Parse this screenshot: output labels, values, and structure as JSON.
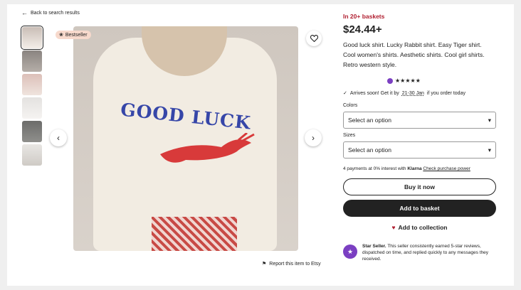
{
  "nav": {
    "back_label": "Back to search results"
  },
  "listing": {
    "badge": "Bestseller",
    "basket_text": "In 20+ baskets",
    "price": "$24.44+",
    "title": "Good luck shirt. Lucky Rabbit shirt. Easy Tiger shirt. Cool women's shirts. Aesthetic shirts. Cool girl shirts. Retro western style.",
    "rating_stars": "★★★★★",
    "rating": 5,
    "arrives_prefix": "Arrives soon! Get it by",
    "arrives_dates": "21-30 Jan",
    "arrives_suffix": "if you order today",
    "print_text": "GOOD LUCK"
  },
  "options": {
    "colors_label": "Colors",
    "colors_value": "Select an option",
    "sizes_label": "Sizes",
    "sizes_value": "Select an option"
  },
  "payment": {
    "prefix": "4 payments at 0% interest with",
    "brand": "Klarna",
    "link": "Check purchase power"
  },
  "actions": {
    "buy_now": "Buy it now",
    "add_to_basket": "Add to basket",
    "add_to_collection": "Add to collection",
    "report": "Report this item to Etsy"
  },
  "seller": {
    "title": "Star Seller.",
    "text": "This seller consistently earned 5-star reviews, dispatched on time, and replied quickly to any messages they received."
  },
  "colors": {
    "accent": "#b01e2f",
    "star_badge": "#7b3fc2",
    "dark": "#222222"
  },
  "icons": [
    "arrow-left-icon",
    "heart-icon",
    "chevron-left-icon",
    "chevron-right-icon",
    "flag-icon",
    "check-icon",
    "chevron-down-icon",
    "star-seller-icon",
    "bestseller-icon"
  ]
}
